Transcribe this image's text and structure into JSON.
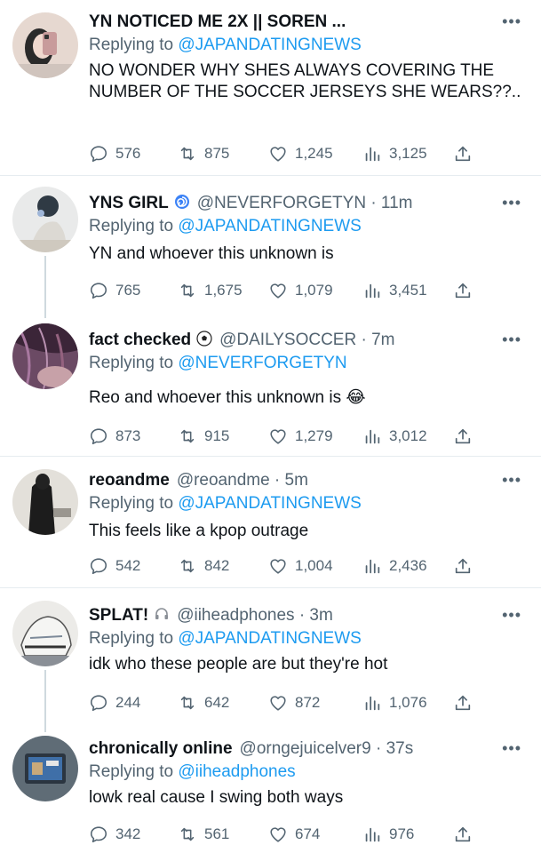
{
  "tweets": [
    {
      "name": "YN NOTICED ME 2X || SOREN ...",
      "badge": "",
      "handle": "",
      "time": "",
      "reply_prefix": "Replying to ",
      "reply_to": "@JAPANDATINGNEWS",
      "text": "NO WONDER WHY SHES ALWAYS COVERING THE NUMBER OF THE SOCCER JERSEYS SHE WEARS??..",
      "replies": "576",
      "retweets": "875",
      "likes": "1,245",
      "views": "3,125",
      "avatar_colors": [
        "#d9c7bf",
        "#2a2a2a",
        "#c89b9b"
      ]
    },
    {
      "name": "YNS GIRL",
      "badge": "spiral-emoji",
      "handle": "@NEVERFORGETYN · 11m",
      "reply_prefix": "Replying to ",
      "reply_to": "@JAPANDATINGNEWS",
      "text": "YN and whoever this unknown is",
      "replies": "765",
      "retweets": "1,675",
      "likes": "1,079",
      "views": "3,451",
      "avatar_colors": [
        "#dfe3e6",
        "#9aa7b0",
        "#2f3a44"
      ]
    },
    {
      "name": "fact checked",
      "badge": "soccer-ball-emoji",
      "handle": "@DAILYSOCCER · 7m",
      "reply_prefix": "Replying to ",
      "reply_to": "@NEVERFORGETYN",
      "text": "Reo and whoever this unknown is",
      "text_emoji": "😂",
      "replies": "873",
      "retweets": "915",
      "likes": "1,279",
      "views": "3,012",
      "avatar_colors": [
        "#4a2f47",
        "#8a5a7e",
        "#c5a3b8"
      ]
    },
    {
      "name": "reoandme",
      "badge": "",
      "handle": "@reoandme · 5m",
      "reply_prefix": "Replying to ",
      "reply_to": "@JAPANDATINGNEWS",
      "text": "This feels like a kpop outrage",
      "replies": "542",
      "retweets": "842",
      "likes": "1,004",
      "views": "2,436",
      "avatar_colors": [
        "#e7e4df",
        "#1c1c1c",
        "#8f8b85"
      ]
    },
    {
      "name": "SPLAT!",
      "badge": "headphones-emoji",
      "handle": "@iiheadphones · 3m",
      "reply_prefix": "Replying to ",
      "reply_to": "@JAPANDATINGNEWS",
      "text": "idk who these people are but they're hot",
      "replies": "244",
      "retweets": "642",
      "likes": "872",
      "views": "1,076",
      "avatar_colors": [
        "#e8e6e3",
        "#7d8a99",
        "#3a3a3a"
      ]
    },
    {
      "name": "chronically online",
      "badge": "",
      "handle": "@orngejuicelver9 · 37s",
      "reply_prefix": "Replying to ",
      "reply_to": "@iiheadphones",
      "text": "lowk real cause I swing both ways",
      "replies": "342",
      "retweets": "561",
      "likes": "674",
      "views": "976",
      "avatar_colors": [
        "#6a7a86",
        "#3f6fa8",
        "#c9a97a"
      ]
    }
  ],
  "more_icon": "more-dots-icon",
  "colors": {
    "link": "#1d9bf0",
    "muted": "#536471",
    "text": "#0f1419",
    "divider": "#e6ecf0",
    "thread": "#cfd9de"
  }
}
